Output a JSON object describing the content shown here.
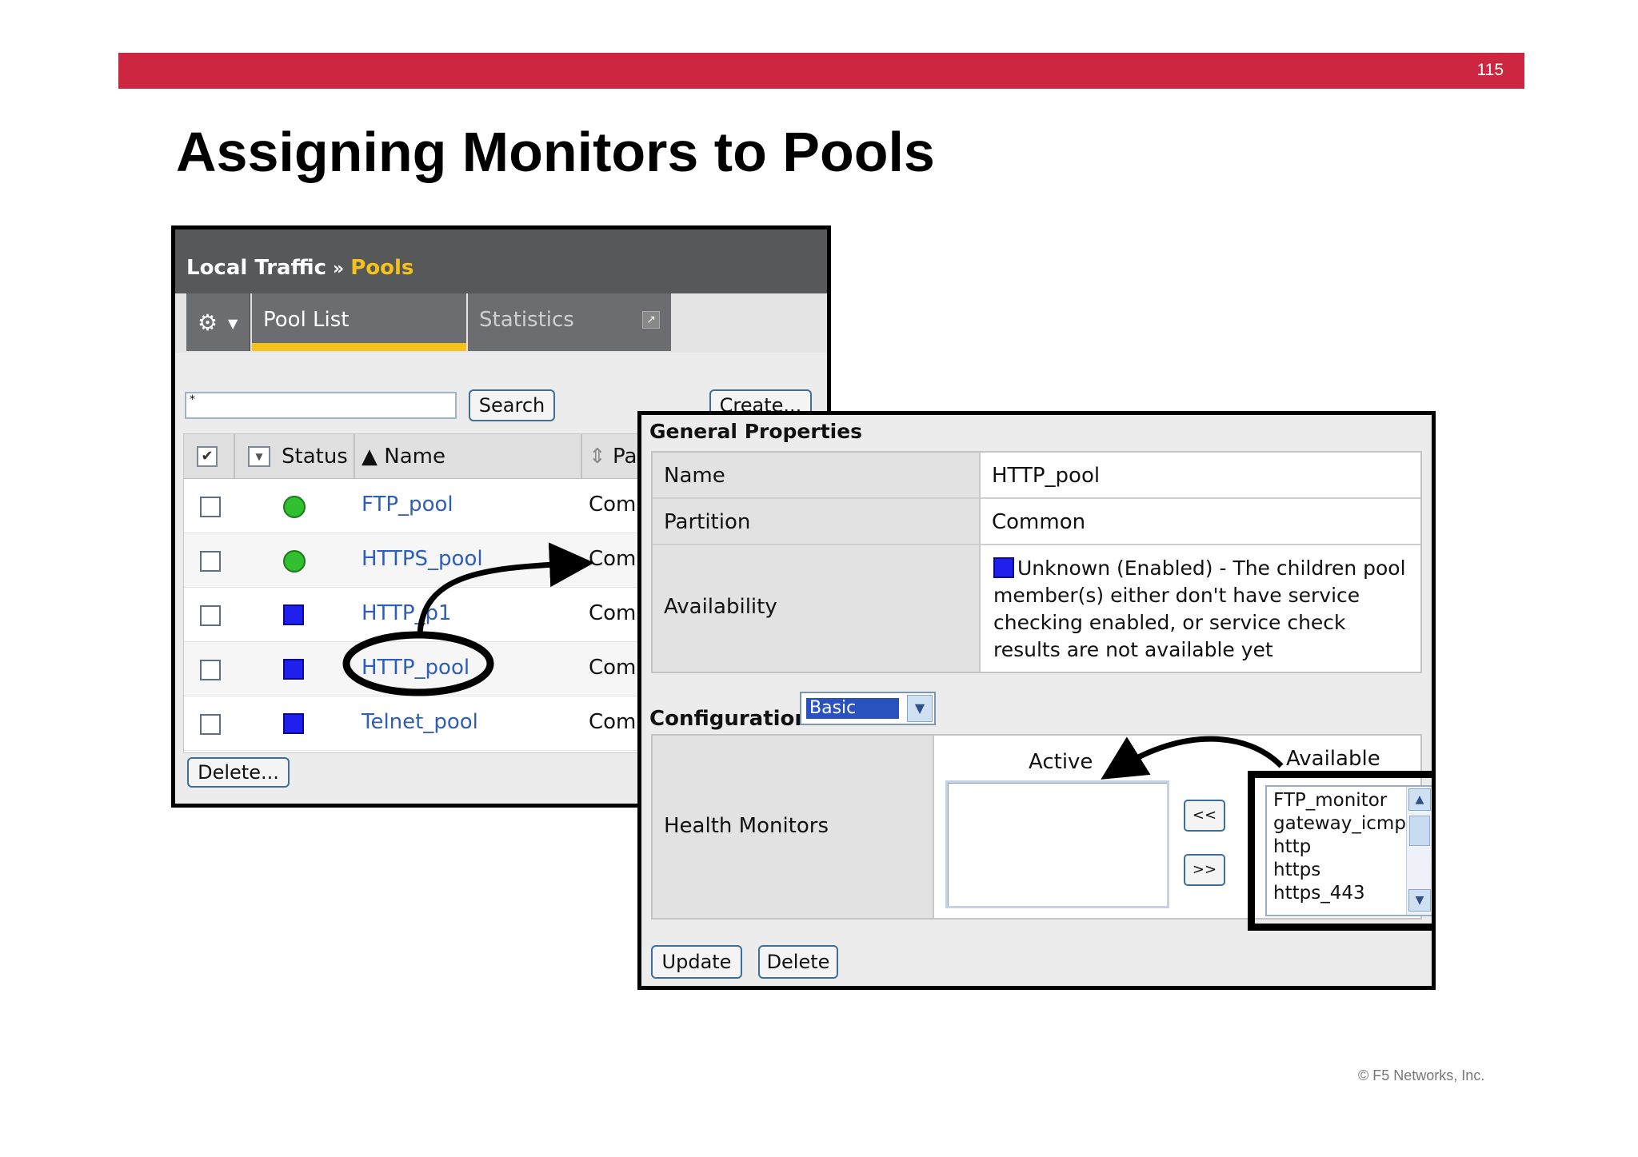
{
  "slide": {
    "page_number": "115",
    "title": "Assigning Monitors to Pools",
    "copyright": "© F5 Networks, Inc.",
    "accent_color": "#cc2641"
  },
  "pool_panel": {
    "breadcrumb": {
      "section": "Local Traffic",
      "separator": "»",
      "current": "Pools"
    },
    "tabs": {
      "gear_icon": "gear-icon",
      "pool_list": "Pool List",
      "statistics": "Statistics"
    },
    "search": {
      "value": "*",
      "button": "Search"
    },
    "create_button": "Create...",
    "columns": {
      "status": "Status",
      "name": "▲ Name",
      "partition": "Pa"
    },
    "rows": [
      {
        "status": "green",
        "name": "FTP_pool",
        "partition": "Comm"
      },
      {
        "status": "green",
        "name": "HTTPS_pool",
        "partition": "Comm"
      },
      {
        "status": "blue",
        "name": "HTTP_p1",
        "partition": "Comm"
      },
      {
        "status": "blue",
        "name": "HTTP_pool",
        "partition": "Comm"
      },
      {
        "status": "blue",
        "name": "Telnet_pool",
        "partition": "Comm"
      }
    ],
    "delete_button": "Delete..."
  },
  "properties_panel": {
    "general_title": "General Properties",
    "name_label": "Name",
    "name_value": "HTTP_pool",
    "partition_label": "Partition",
    "partition_value": "Common",
    "availability_label": "Availability",
    "availability_value": "Unknown (Enabled) - The children pool member(s) either don't have service checking enabled, or service check results are not available yet",
    "configuration_label": "Configuration:",
    "configuration_value": "Basic",
    "health_monitors_label": "Health Monitors",
    "active_label": "Active",
    "available_label": "Available",
    "move_left": "<<",
    "move_right": ">>",
    "available_monitors": [
      "FTP_monitor",
      "gateway_icmp",
      "http",
      "https",
      "https_443"
    ],
    "update_button": "Update",
    "delete_button": "Delete"
  }
}
